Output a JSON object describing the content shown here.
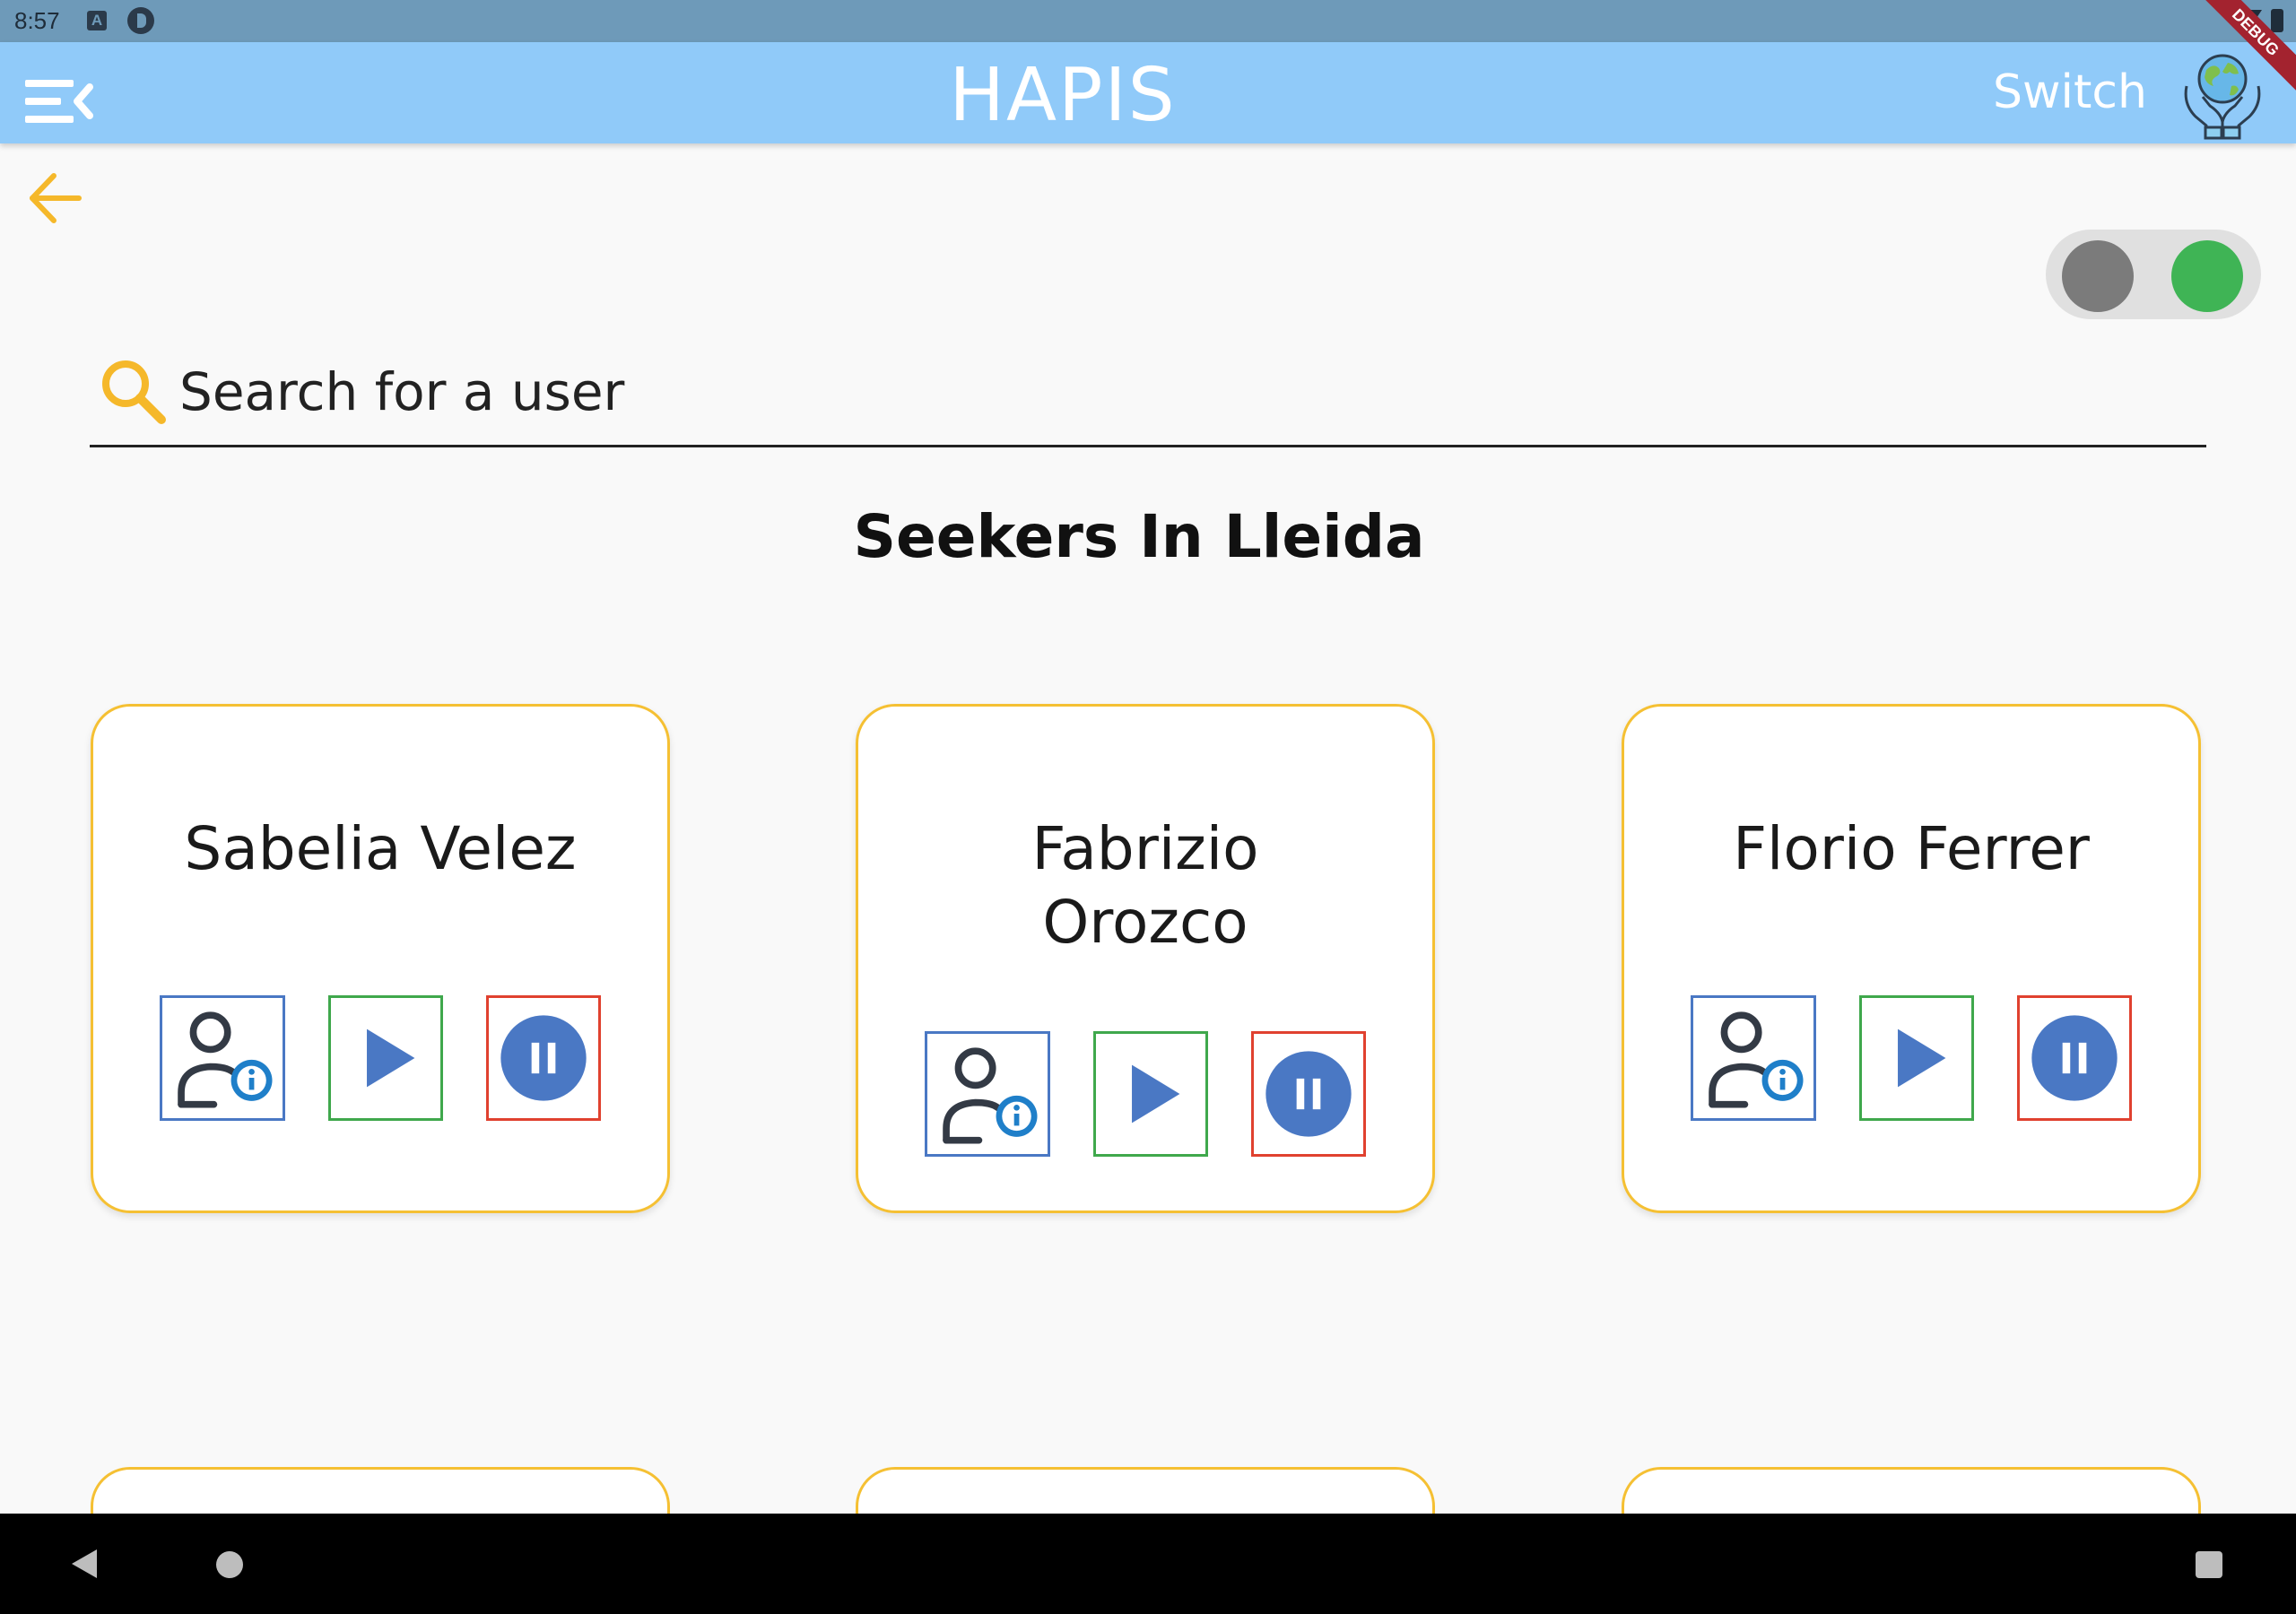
{
  "status_bar": {
    "time": "8:57",
    "icon_a": "A",
    "debug_label": "DEBUG"
  },
  "app_bar": {
    "title": "HAPIS",
    "switch_label": "Switch",
    "menu_icon": "menu-open-icon",
    "logo_icon": "hands-globe-icon",
    "color": "#90caf9"
  },
  "page": {
    "back_icon": "arrow-left-icon",
    "toggle": {
      "left_state_color": "#7b7b7b",
      "right_state_color": "#3fb455"
    },
    "search": {
      "placeholder": "Search for a user",
      "value": ""
    },
    "section_title": "Seekers In Lleida"
  },
  "cards": [
    {
      "name": "Sabelia Velez",
      "actions": [
        "user-info-icon",
        "play-icon",
        "pause-icon"
      ]
    },
    {
      "name": "Fabrizio Orozco",
      "name_lines": [
        "Fabrizio",
        "Orozco"
      ],
      "actions": [
        "user-info-icon",
        "play-icon",
        "pause-icon"
      ]
    },
    {
      "name": "Florio Ferrer",
      "actions": [
        "user-info-icon",
        "play-icon",
        "pause-icon"
      ]
    }
  ],
  "colors": {
    "accent": "#f5c033",
    "info": "#4a78c4",
    "play": "#3fa84c",
    "pause": "#e0412f",
    "background": "#f9f9f9"
  },
  "nav_bar": {
    "back": "nav-back-icon",
    "home": "nav-home-icon",
    "recents": "nav-recents-icon"
  }
}
